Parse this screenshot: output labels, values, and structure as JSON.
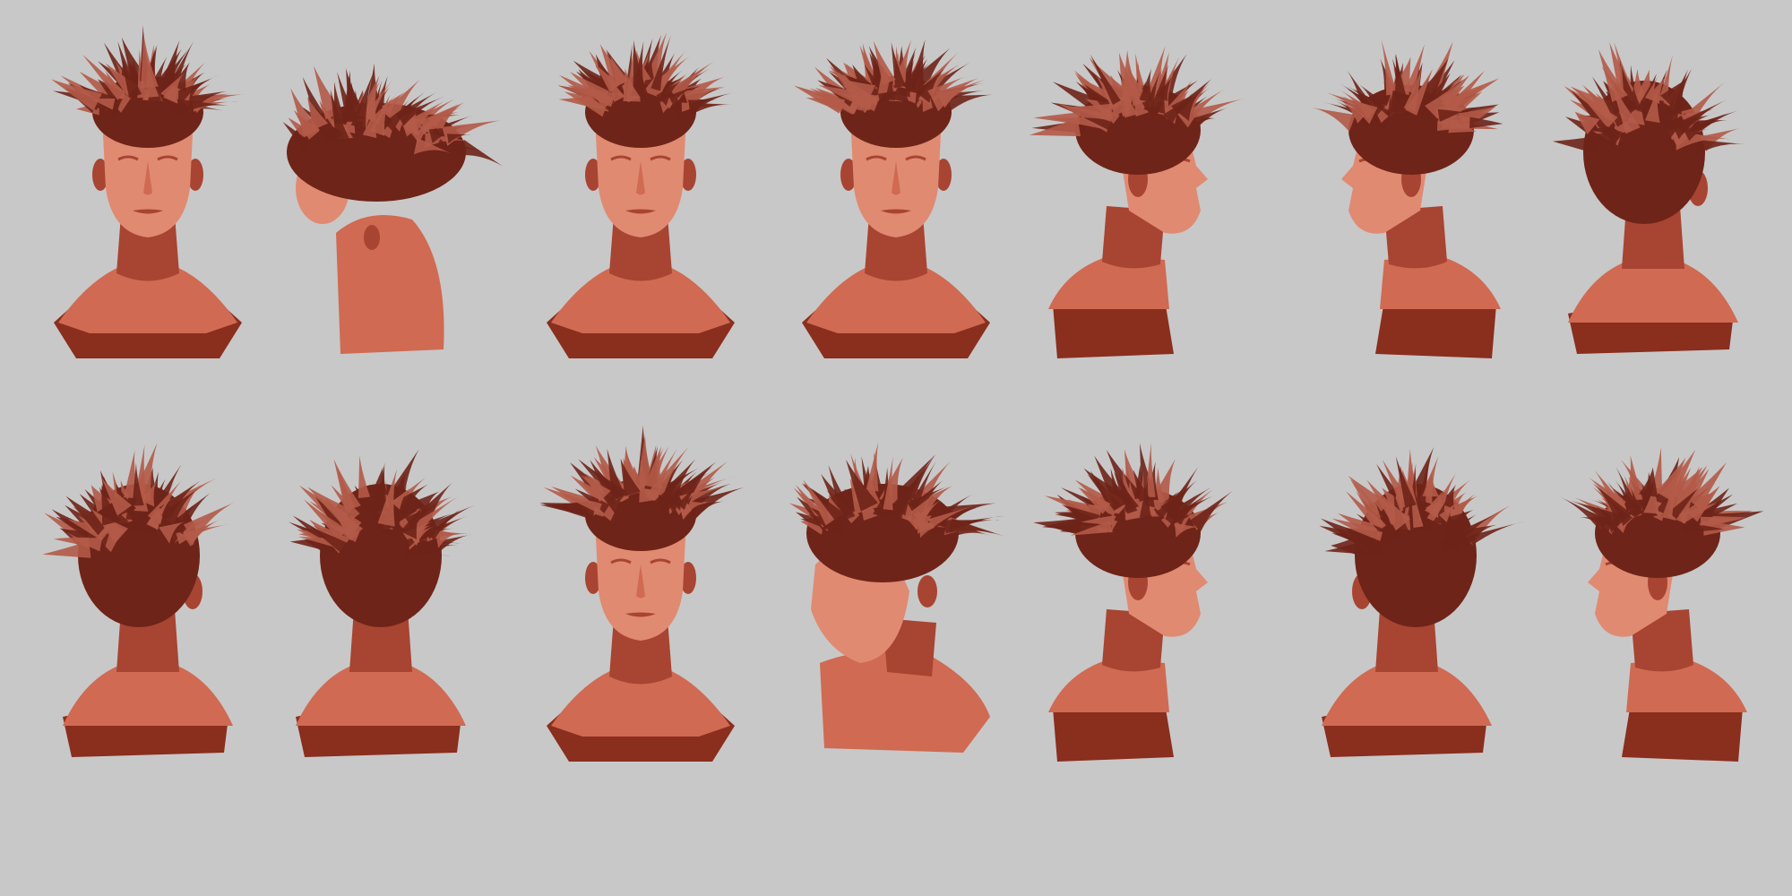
{
  "canvas": {
    "background_color": "#c8c8c8"
  },
  "palette": {
    "skin_light": "#e08a72",
    "skin_mid": "#d06a52",
    "skin_dark": "#a84432",
    "hair_light": "#b35a48",
    "hair_dark": "#6e2418",
    "base_dark": "#8a2e1e"
  },
  "views": [
    {
      "row": 1,
      "col": 1,
      "view": "front",
      "tilt": 0
    },
    {
      "row": 1,
      "col": 2,
      "view": "top-back-three-quarter",
      "tilt": 0
    },
    {
      "row": 1,
      "col": 3,
      "view": "front",
      "tilt": 0
    },
    {
      "row": 1,
      "col": 4,
      "view": "front",
      "tilt": 0
    },
    {
      "row": 1,
      "col": 5,
      "view": "profile-right",
      "tilt": 0
    },
    {
      "row": 1,
      "col": 6,
      "view": "three-quarter-left",
      "tilt": 0
    },
    {
      "row": 1,
      "col": 7,
      "view": "back-three-quarter-right",
      "tilt": 0
    },
    {
      "row": 2,
      "col": 1,
      "view": "back-three-quarter-right",
      "tilt": 0
    },
    {
      "row": 2,
      "col": 2,
      "view": "back",
      "tilt": 0
    },
    {
      "row": 2,
      "col": 3,
      "view": "front",
      "tilt": 0
    },
    {
      "row": 2,
      "col": 4,
      "view": "three-quarter-down-left",
      "tilt": 0
    },
    {
      "row": 2,
      "col": 5,
      "view": "profile-right",
      "tilt": 0
    },
    {
      "row": 2,
      "col": 6,
      "view": "back-three-quarter-left",
      "tilt": 0
    },
    {
      "row": 2,
      "col": 7,
      "view": "three-quarter-left",
      "tilt": 0
    }
  ]
}
